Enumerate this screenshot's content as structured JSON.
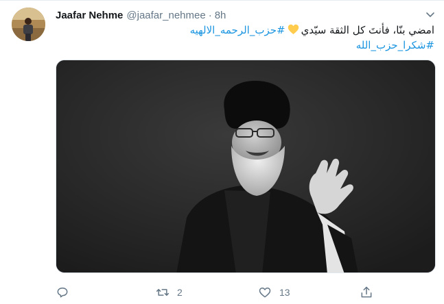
{
  "tweet": {
    "author_name": "Jaafar Nehme",
    "author_handle": "@jaafar_nehmee",
    "separator": "·",
    "time": "8h",
    "text_main": "امضي بنّا، فأنتَ كل الثقة سيّدي",
    "heart_emoji": "yellow-heart",
    "hashtag_1": "#حزب_الرحمه_الالهيه",
    "hashtag_2": "#شكرا_حزب_الله"
  },
  "actions": {
    "reply_icon": "reply-icon",
    "retweet_icon": "retweet-icon",
    "retweet_count": "2",
    "like_icon": "heart-icon",
    "like_count": "13",
    "share_icon": "share-icon"
  },
  "colors": {
    "link": "#1b95e0",
    "muted": "#657786",
    "heart": "#ffcc4d"
  }
}
